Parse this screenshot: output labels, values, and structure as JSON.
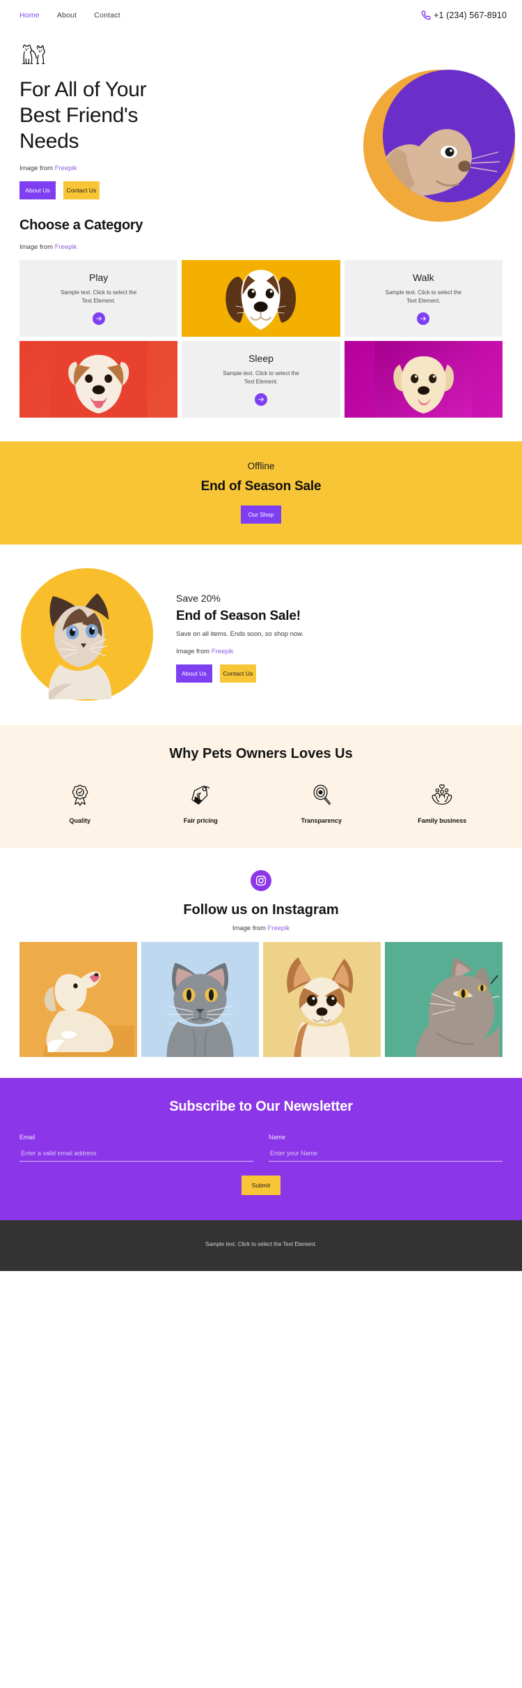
{
  "nav": {
    "links": [
      {
        "label": "Home",
        "active": true
      },
      {
        "label": "About",
        "active": false
      },
      {
        "label": "Contact",
        "active": false
      }
    ],
    "phone": "+1 (234) 567-8910",
    "phone_icon": "phone-icon"
  },
  "hero": {
    "logo_icon": "dog-cat-logo-icon",
    "title": "For All of Your Best Friend's Needs",
    "credit_prefix": "Image from ",
    "credit_link": "Freepik",
    "buttons": [
      {
        "label": "About Us",
        "style": "purple"
      },
      {
        "label": "Contact Us",
        "style": "yellow"
      }
    ],
    "image_alt": "french-bulldog-on-purple-and-yellow-circles"
  },
  "category": {
    "heading": "Choose a Category",
    "credit_prefix": "Image from ",
    "credit_link": "Freepik",
    "cells": [
      {
        "kind": "text",
        "title": "Play",
        "sample": "Sample text. Click to select the Text Element.",
        "arrow_icon": "arrow-right-icon"
      },
      {
        "kind": "photo",
        "alt": "beagle-puppy-on-yellow",
        "bg": "#f3b001"
      },
      {
        "kind": "text",
        "title": "Walk",
        "sample": "Sample text. Click to select the Text Element.",
        "arrow_icon": "arrow-right-icon"
      },
      {
        "kind": "photo",
        "alt": "english-bulldog-on-red",
        "bg": "#e8412f"
      },
      {
        "kind": "text",
        "title": "Sleep",
        "sample": "Sample text. Click to select the Text Element.",
        "arrow_icon": "arrow-right-icon"
      },
      {
        "kind": "photo",
        "alt": "golden-retriever-puppy-on-magenta",
        "bg": "#b5009c"
      }
    ]
  },
  "sale_banner": {
    "kicker": "Offline",
    "title": "End of Season Sale",
    "button": "Our Shop"
  },
  "promo": {
    "kicker": "Save 20%",
    "title": "End of Season Sale!",
    "description": "Save on all items. Ends soon, so shop now.",
    "credit_prefix": "Image from ",
    "credit_link": "Freepik",
    "buttons": [
      {
        "label": "About Us",
        "style": "purple"
      },
      {
        "label": "Contact Us",
        "style": "yellow"
      }
    ],
    "image_alt": "siamese-cat-on-yellow-circle"
  },
  "why": {
    "heading": "Why Pets Owners Loves Us",
    "features": [
      {
        "label": "Quality",
        "icon": "award-badge-icon"
      },
      {
        "label": "Fair pricing",
        "icon": "price-tag-icon"
      },
      {
        "label": "Transparency",
        "icon": "magnifier-eye-icon"
      },
      {
        "label": "Family business",
        "icon": "hands-family-icon"
      }
    ]
  },
  "instagram": {
    "badge_icon": "instagram-icon",
    "heading": "Follow us on Instagram",
    "credit_prefix": "Image from ",
    "credit_link": "Freepik",
    "photos": [
      {
        "alt": "howling-dog-on-orange",
        "bg": "#eeab4a"
      },
      {
        "alt": "grey-cat-on-light-blue",
        "bg": "#bed8f0"
      },
      {
        "alt": "chihuahua-on-pale-yellow",
        "bg": "#efd28a"
      },
      {
        "alt": "grey-cat-looking-up-on-green",
        "bg": "#58ae93"
      }
    ]
  },
  "newsletter": {
    "heading": "Subscribe to Our Newsletter",
    "email_label": "Email",
    "email_placeholder": "Enter a valid email address",
    "email_value": "",
    "name_label": "Name",
    "name_placeholder": "Enter your Name",
    "name_value": "",
    "submit": "Submit"
  },
  "footer": {
    "text": "Sample text. Click to select the Text Element."
  },
  "colors": {
    "purple": "#7e3ff2",
    "purple_deep": "#8b36e8",
    "yellow": "#f8c537",
    "orange": "#f1a93a",
    "cream": "#fdf4e7",
    "grey_card": "#f0f0f0",
    "footer_dark": "#333333"
  }
}
